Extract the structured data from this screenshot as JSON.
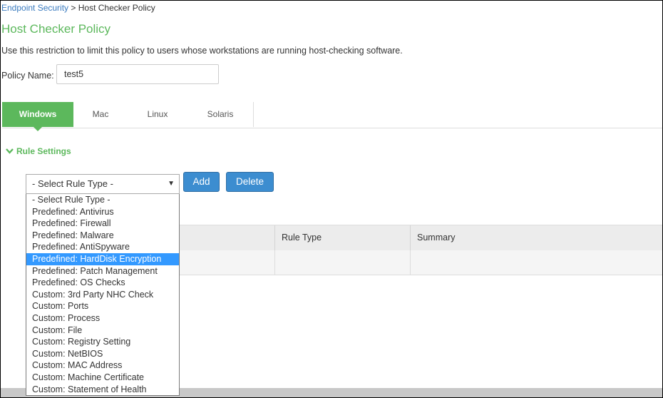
{
  "breadcrumb": {
    "link": "Endpoint Security",
    "separator": " > ",
    "current": "Host Checker Policy"
  },
  "page_title": "Host Checker Policy",
  "description": "Use this restriction to limit this policy to users whose workstations are running host-checking software.",
  "policy_name": {
    "label": "Policy Name:",
    "value": "test5"
  },
  "tabs": [
    {
      "label": "Windows",
      "active": true
    },
    {
      "label": "Mac",
      "active": false
    },
    {
      "label": "Linux",
      "active": false
    },
    {
      "label": "Solaris",
      "active": false
    }
  ],
  "rule_settings": {
    "label": "Rule Settings",
    "icon": "chevron-down-icon"
  },
  "rule_type_select": {
    "selected": "- Select Rule Type -",
    "options": [
      "- Select Rule Type -",
      "Predefined: Antivirus",
      "Predefined: Firewall",
      "Predefined: Malware",
      "Predefined: AntiSpyware",
      "Predefined: HardDisk Encryption",
      "Predefined: Patch Management",
      "Predefined: OS Checks",
      "Custom: 3rd Party NHC Check",
      "Custom: Ports",
      "Custom: Process",
      "Custom: File",
      "Custom: Registry Setting",
      "Custom: NetBIOS",
      "Custom: MAC Address",
      "Custom: Machine Certificate",
      "Custom: Statement of Health"
    ],
    "highlighted_index": 5
  },
  "buttons": {
    "add": "Add",
    "delete": "Delete"
  },
  "table": {
    "columns": [
      "",
      "Rule Type",
      "Summary"
    ]
  },
  "colors": {
    "accent_green": "#5cb85c",
    "button_blue": "#3c8dd0",
    "link_blue": "#3a7bbf",
    "highlight_blue": "#3399ff"
  }
}
